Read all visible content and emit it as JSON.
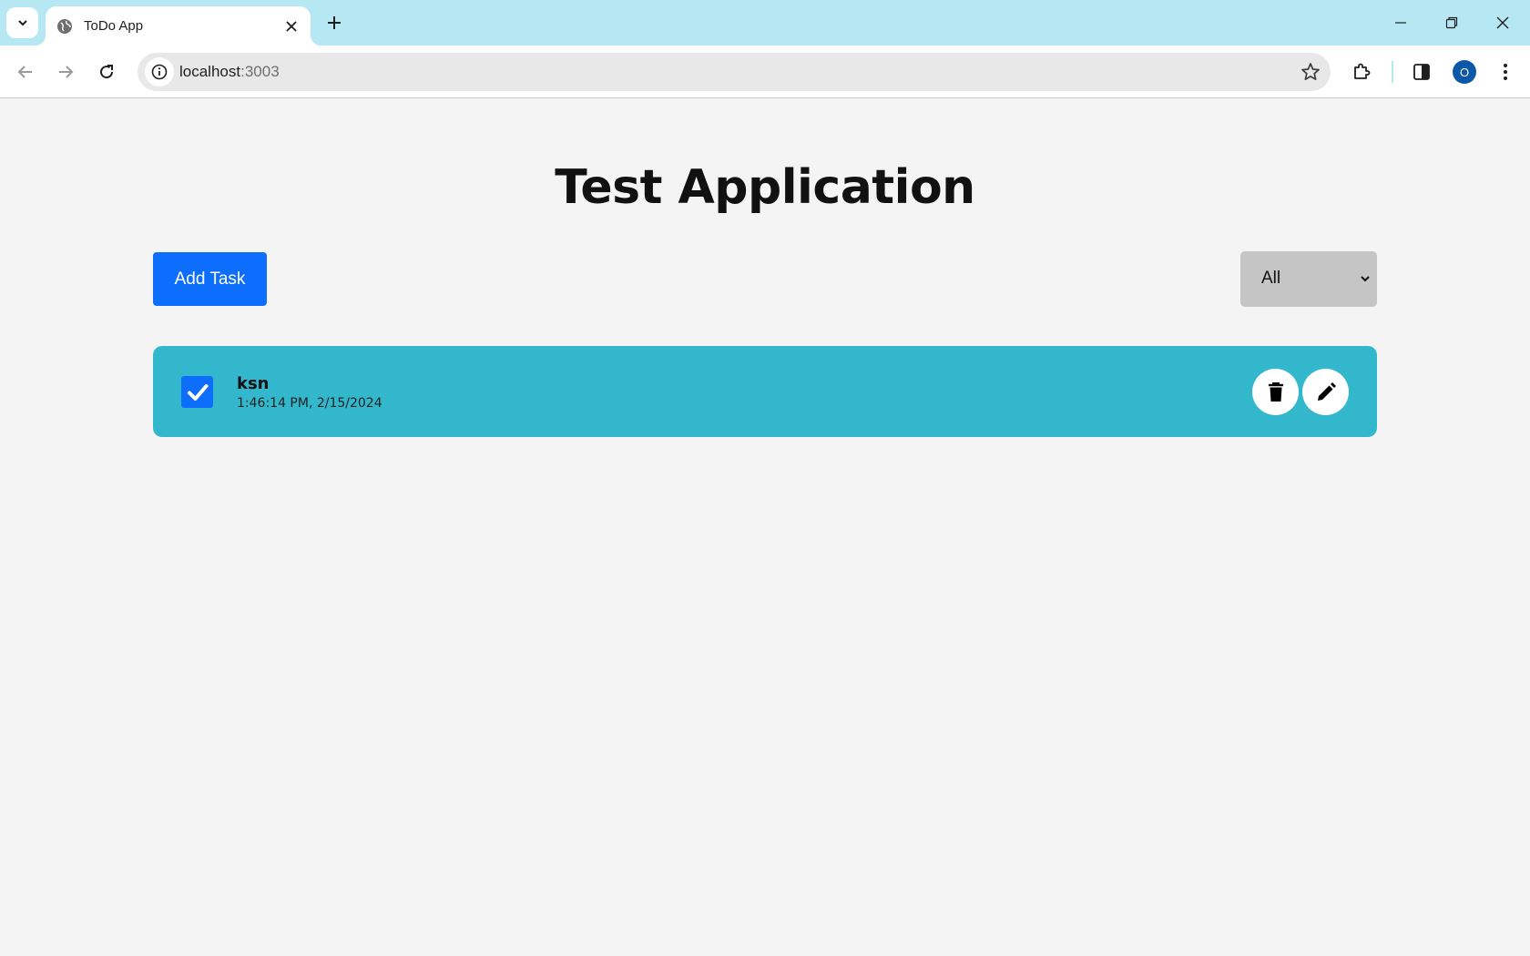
{
  "browser": {
    "tab_title": "ToDo App",
    "url_host": "localhost",
    "url_port": ":3003",
    "profile_initial": "O"
  },
  "app": {
    "title": "Test Application",
    "add_button_label": "Add Task",
    "filter": {
      "selected": "All"
    },
    "tasks": [
      {
        "title": "ksn",
        "time": "1:46:14 PM, 2/15/2024",
        "completed": true
      }
    ]
  },
  "colors": {
    "tabstrip": "#b6e8f4",
    "primary_button": "#0d6efd",
    "task_card": "#32b7cd",
    "filter_bg": "#c5c5c5",
    "page_bg": "#f4f4f4"
  },
  "icons": [
    "chevron-down-icon",
    "globe-icon",
    "close-icon",
    "plus-icon",
    "minimize-icon",
    "restore-icon",
    "back-icon",
    "forward-icon",
    "reload-icon",
    "info-icon",
    "star-icon",
    "extensions-icon",
    "side-panel-icon",
    "more-icon",
    "check-icon",
    "trash-icon",
    "pencil-icon"
  ]
}
